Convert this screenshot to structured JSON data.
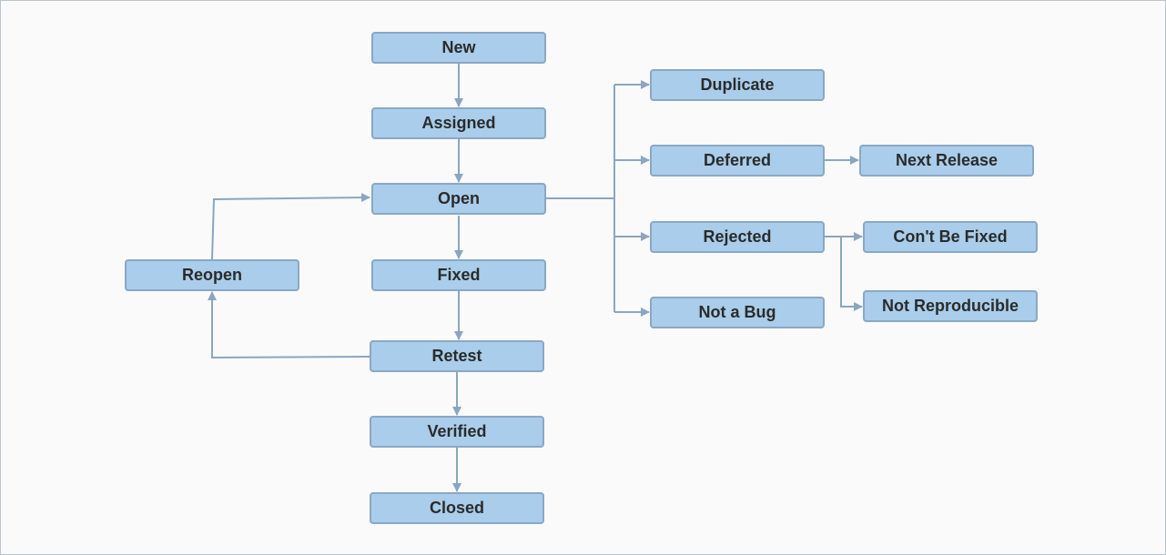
{
  "diagram": {
    "colors": {
      "node_fill": "#a9cdea",
      "node_border": "#8aa8c4",
      "edge": "#8ba6c0",
      "background": "#fafafa"
    },
    "nodes": {
      "new": "New",
      "assigned": "Assigned",
      "open": "Open",
      "fixed": "Fixed",
      "retest": "Retest",
      "verified": "Verified",
      "closed": "Closed",
      "reopen": "Reopen",
      "duplicate": "Duplicate",
      "deferred": "Deferred",
      "rejected": "Rejected",
      "not_a_bug": "Not a Bug",
      "next_release": "Next Release",
      "cant_be_fixed": "Con't Be Fixed",
      "not_reproducible": "Not Reproducible"
    },
    "edges": [
      [
        "new",
        "assigned"
      ],
      [
        "assigned",
        "open"
      ],
      [
        "open",
        "fixed"
      ],
      [
        "fixed",
        "retest"
      ],
      [
        "retest",
        "verified"
      ],
      [
        "verified",
        "closed"
      ],
      [
        "retest",
        "reopen"
      ],
      [
        "reopen",
        "open"
      ],
      [
        "open",
        "duplicate"
      ],
      [
        "open",
        "deferred"
      ],
      [
        "open",
        "rejected"
      ],
      [
        "open",
        "not_a_bug"
      ],
      [
        "deferred",
        "next_release"
      ],
      [
        "rejected",
        "cant_be_fixed"
      ],
      [
        "rejected",
        "not_reproducible"
      ]
    ]
  }
}
